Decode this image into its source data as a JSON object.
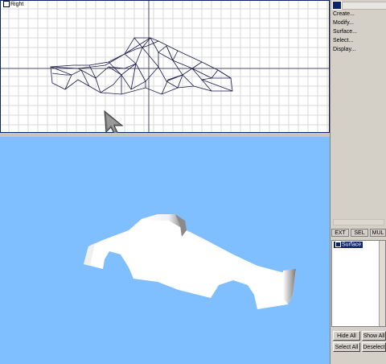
{
  "viewport_right": {
    "label": "Right"
  },
  "menu": {
    "items": [
      "Create...",
      "Modify...",
      "Surface...",
      "Select...",
      "Display..."
    ]
  },
  "tabs": [
    "EXT",
    "SEL",
    "MUL"
  ],
  "surface_list": {
    "items": [
      "Surface"
    ]
  },
  "buttons": {
    "hide_all": "Hide All",
    "show_all": "Show All",
    "select_all": "Select All",
    "deselect": "Deselect"
  },
  "colors": {
    "perspective_bg": "#80bfff",
    "wireframe": "#1a1a4a",
    "selection": "#0a246a"
  }
}
